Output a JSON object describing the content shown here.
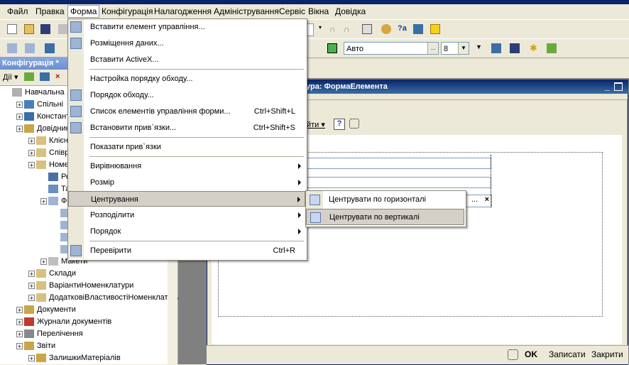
{
  "menubar": {
    "items": [
      "Файл",
      "Правка",
      "Форма",
      "Конфігурація",
      "Налагодження",
      "Адміністрування",
      "Сервіс",
      "Вікна",
      "Довідка"
    ]
  },
  "toolbar2": {
    "font_value": "Авто",
    "size_value": "8"
  },
  "left_panel": {
    "title": "Конфігурація *",
    "actions_label": "Дії",
    "tree": [
      {
        "label": "Навчальна",
        "indent": 0
      },
      {
        "label": "Спільні",
        "indent": 1
      },
      {
        "label": "Константи",
        "indent": 1
      },
      {
        "label": "Довідники",
        "indent": 1
      },
      {
        "label": "Клієнти",
        "indent": 2
      },
      {
        "label": "Співробітники",
        "indent": 2
      },
      {
        "label": "Номенклатура",
        "indent": 2
      },
      {
        "label": "Реквізити",
        "indent": 3
      },
      {
        "label": "Табличні частини",
        "indent": 3
      },
      {
        "label": "Форми",
        "indent": 3
      },
      {
        "label": "",
        "indent": 4
      },
      {
        "label": "",
        "indent": 4
      },
      {
        "label": "",
        "indent": 4
      },
      {
        "label": "",
        "indent": 4
      },
      {
        "label": "Макети",
        "indent": 3
      },
      {
        "label": "Склади",
        "indent": 2
      },
      {
        "label": "ВаріантиНоменклатури",
        "indent": 2
      },
      {
        "label": "ДодатковіВластивостіНоменклатури",
        "indent": 2
      },
      {
        "label": "Документи",
        "indent": 1
      },
      {
        "label": "Журнали документів",
        "indent": 1
      },
      {
        "label": "Перелічення",
        "indent": 1
      },
      {
        "label": "Звіти",
        "indent": 1
      },
      {
        "label": "ЗалишкиМатеріалів",
        "indent": 2
      }
    ]
  },
  "form_window": {
    "title": "ура: ФормаЕлемента",
    "inner_actions": "йти",
    "buttons": {
      "ok": "OK",
      "save": "Записати",
      "close": "Закрити"
    }
  },
  "dropdown": {
    "items": [
      {
        "label": "Вставити елемент управління...",
        "shortcut": "",
        "submenu": false
      },
      {
        "label": "Розміщення даних...",
        "shortcut": "",
        "submenu": false
      },
      {
        "label": "Вставити ActiveX...",
        "shortcut": "",
        "submenu": false
      },
      {
        "label": "Настройка порядку обходу...",
        "shortcut": "",
        "submenu": false
      },
      {
        "label": "Порядок обходу...",
        "shortcut": "",
        "submenu": false
      },
      {
        "label": "Список елементів управління форми...",
        "shortcut": "Ctrl+Shift+L",
        "submenu": false
      },
      {
        "label": "Встановити прив`язки...",
        "shortcut": "Ctrl+Shift+S",
        "submenu": false
      },
      {
        "label": "Показати прив`язки",
        "shortcut": "",
        "submenu": false
      },
      {
        "label": "Вирівнювання",
        "shortcut": "",
        "submenu": true
      },
      {
        "label": "Розмір",
        "shortcut": "",
        "submenu": true
      },
      {
        "label": "Центрування",
        "shortcut": "",
        "submenu": true
      },
      {
        "label": "Розподілити",
        "shortcut": "",
        "submenu": true
      },
      {
        "label": "Порядок",
        "shortcut": "",
        "submenu": true
      },
      {
        "label": "Перевірити",
        "shortcut": "Ctrl+R",
        "submenu": false
      }
    ]
  },
  "submenu": {
    "items": [
      "Центрувати по горизонталі",
      "Центрувати по вертикалі"
    ]
  },
  "colors": {
    "highlight": "#d4d0c8",
    "title_blue": "#0a246a"
  }
}
